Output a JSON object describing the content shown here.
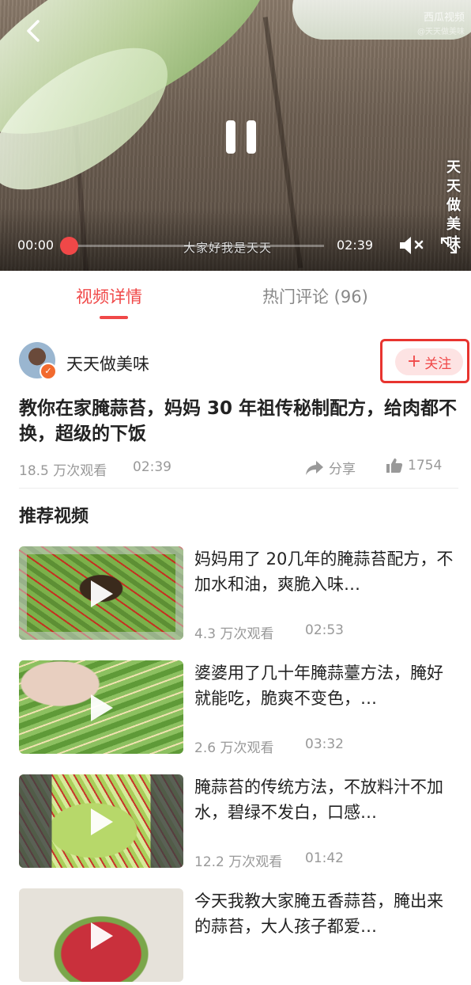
{
  "player": {
    "watermark_logo": "西瓜视频",
    "watermark_handle": "@天天做美味",
    "vertical_brand": [
      "天",
      "天",
      "做",
      "美",
      "味"
    ],
    "subtitle": "大家好我是天天",
    "current_time": "00:00",
    "total_time": "02:39",
    "progress_fraction": 0.0
  },
  "tabs": [
    {
      "label": "视频详情",
      "active": true
    },
    {
      "label": "热门评论 (96)",
      "active": false
    }
  ],
  "author": {
    "name": "天天做美味",
    "follow_label": "关注",
    "follow_icon": "+"
  },
  "video": {
    "title": "教你在家腌蒜苔，妈妈 30 年祖传秘制配方，给肉都不换，超级的下饭",
    "views": "18.5 万次观看",
    "duration": "02:39",
    "share_label": "分享",
    "like_count": "1754"
  },
  "recommended": {
    "heading": "推荐视频",
    "items": [
      {
        "title": "妈妈用了 20几年的腌蒜苔配方，不加水和油，爽脆入味…",
        "views": "4.3 万次观看",
        "duration": "02:53"
      },
      {
        "title": "婆婆用了几十年腌蒜薹方法，腌好就能吃，脆爽不变色，…",
        "views": "2.6 万次观看",
        "duration": "03:32"
      },
      {
        "title": "腌蒜苔的传统方法，不放料汁不加水，碧绿不发白，口感…",
        "views": "12.2 万次观看",
        "duration": "01:42"
      },
      {
        "title": "今天我教大家腌五香蒜苔，腌出来的蒜苔，大人孩子都爱…",
        "views": "",
        "duration": ""
      }
    ]
  },
  "colors": {
    "accent": "#f04848",
    "muted_text": "#999999",
    "highlight_box": "#e8342f"
  }
}
